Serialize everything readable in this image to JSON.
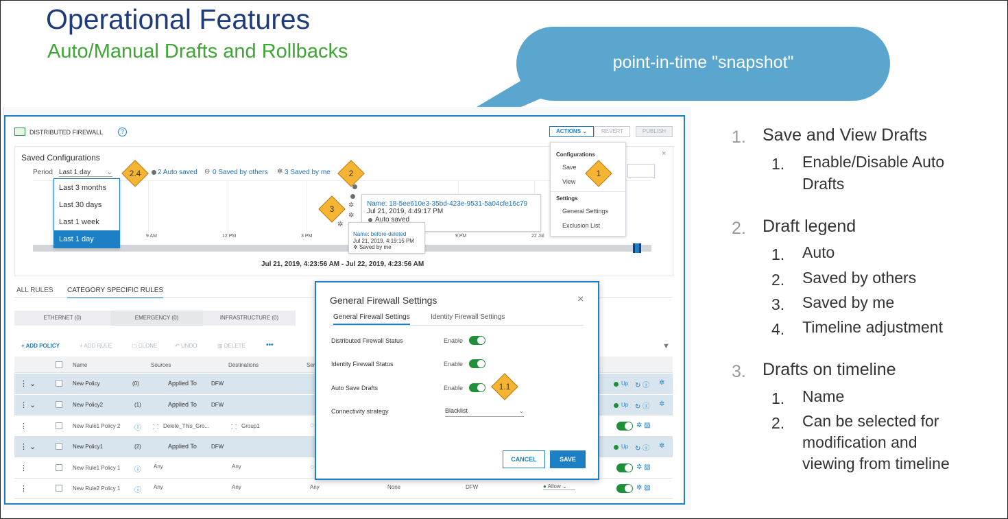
{
  "slide": {
    "title": "Operational Features",
    "subtitle": "Auto/Manual Drafts and Rollbacks",
    "callout": "point-in-time \"snapshot\""
  },
  "firewall": {
    "header_title": "DISTRIBUTED FIREWALL",
    "help_icon": "?",
    "actions_label": "ACTIONS",
    "revert_label": "REVERT",
    "publish_label": "PUBLISH",
    "panel_title": "Saved Configurations",
    "period_label": "Period",
    "period_value": "Last 1 day",
    "period_options": [
      "Last 3 months",
      "Last 30 days",
      "Last 1 week",
      "Last 1 day"
    ],
    "legend_auto": "2 Auto saved",
    "legend_others": "0 Saved by others",
    "legend_me": "3 Saved by me",
    "ticks": [
      "9 AM",
      "12 PM",
      "3 PM",
      "9 PM",
      "22 Jul"
    ],
    "range_label": "Jul 21, 2019, 4:23:56 AM - Jul 22, 2019, 4:23:56 AM",
    "tooltip1": {
      "name": "Name: 18-5ee610e3-35bd-423e-9531-5a04cfe16c79",
      "date": "Jul 21, 2019, 4:49:17 PM",
      "type": "Auto saved"
    },
    "tooltip2": {
      "name": "Name: before-deleted",
      "date": "Jul 21, 2019, 4:19:15 PM",
      "type": "Saved by me"
    },
    "menu": {
      "section1": "Configurations",
      "save": "Save",
      "view": "View",
      "section2": "Settings",
      "general": "General Settings",
      "exclusion": "Exclusion List"
    },
    "tabs": [
      "ALL RULES",
      "CATEGORY SPECIFIC RULES"
    ],
    "categories": [
      "ETHERNET (0)",
      "EMERGENCY (0)",
      "INFRASTRUCTURE (0)"
    ],
    "toolbar": {
      "add_policy": "+ ADD POLICY",
      "add_rule": "+ ADD RULE",
      "clone": "CLONE",
      "undo": "UNDO",
      "delete": "DELETE",
      "more": "•••"
    },
    "columns": {
      "name": "Name",
      "sources": "Sources",
      "destinations": "Destinations",
      "services": "Ser"
    },
    "rows": [
      {
        "name": "New Policy",
        "count": "(0)",
        "applied": "Applied To",
        "dfw": "DFW",
        "status": "Up"
      },
      {
        "name": "New Policy2",
        "count": "(1)",
        "applied": "Applied To",
        "dfw": "DFW",
        "status": "Up"
      },
      {
        "name": "New Rule1 Policy 2",
        "source": "Delete_This_Gro...",
        "dest": "Group1"
      },
      {
        "name": "New Policy1",
        "count": "(2)",
        "applied": "Applied To",
        "dfw": "DFW",
        "status": "Up"
      },
      {
        "name": "New Rule1 Policy 1",
        "source": "Any",
        "dest": "Any"
      },
      {
        "name": "New Rule2 Policy 1",
        "source": "Any",
        "dest": "Any",
        "service": "Any",
        "profile": "None",
        "applied": "DFW",
        "action": "Allow"
      }
    ]
  },
  "dialog": {
    "title": "General Firewall Settings",
    "tab1": "General Firewall Settings",
    "tab2": "Identity Firewall Settings",
    "rows": [
      {
        "label": "Distributed Firewall Status",
        "value": "Enable"
      },
      {
        "label": "Identity Firewall Status",
        "value": "Enable"
      },
      {
        "label": "Auto Save Drafts",
        "value": "Enable"
      },
      {
        "label": "Connectivity strategy",
        "value": "Blacklist"
      }
    ],
    "cancel": "CANCEL",
    "save": "SAVE"
  },
  "badges": {
    "b1": "1",
    "b11": "1.1",
    "b2": "2",
    "b24": "2.4",
    "b3": "3"
  },
  "outline": {
    "i1": {
      "num": "1.",
      "text": "Save and View Drafts"
    },
    "i1_1": {
      "num": "1.",
      "text1": "Enable/Disable Auto",
      "text2": "Drafts"
    },
    "i2": {
      "num": "2.",
      "text": "Draft legend"
    },
    "i2_sub": [
      {
        "num": "1.",
        "text": "Auto"
      },
      {
        "num": "2.",
        "text": "Saved by others"
      },
      {
        "num": "3.",
        "text": "Saved by me"
      },
      {
        "num": "4.",
        "text": "Timeline adjustment"
      }
    ],
    "i3": {
      "num": "3.",
      "text": "Drafts on timeline"
    },
    "i3_sub1": {
      "num": "1.",
      "text": "Name"
    },
    "i3_sub2": {
      "num": "2.",
      "text1": "Can be selected for",
      "text2": "modification and",
      "text3": "viewing from timeline"
    }
  },
  "colors": {
    "title": "#1f3c7a",
    "subtitle": "#3fa535",
    "callout": "#5ba6cf",
    "accent": "#1d7fc4",
    "badge": "#f5b431"
  }
}
